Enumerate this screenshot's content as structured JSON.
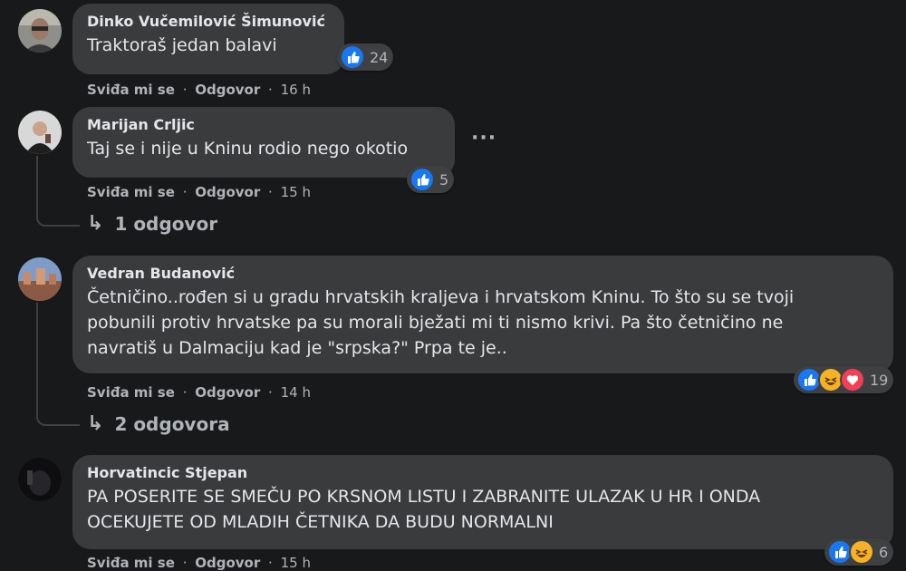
{
  "comments": [
    {
      "author": "Dinko Vučemilović Šimunović",
      "text": "Traktoraš jedan balavi",
      "like": "Sviđa mi se",
      "reply": "Odgovor",
      "time": "16 h",
      "reaction_count": "24"
    },
    {
      "author": "Marijan Crljic",
      "text": "Taj se i nije u Kninu rodio nego okotio",
      "like": "Sviđa mi se",
      "reply": "Odgovor",
      "time": "15 h",
      "reaction_count": "5",
      "replies_label": "1 odgovor"
    },
    {
      "author": "Vedran Budanović",
      "text": "Četničino..rođen si u gradu hrvatskih kraljeva i hrvatskom Kninu. To što su se tvoji\npobunili protiv hrvatske pa su morali bježati mi ti nismo krivi. Pa što četničino ne\nnavratiš u Dalmaciju kad je \"srpska?\" Prpa te je..",
      "like": "Sviđa mi se",
      "reply": "Odgovor",
      "time": "14 h",
      "reaction_count": "19",
      "replies_label": "2 odgovora"
    },
    {
      "author": "Horvatincic Stjepan",
      "text": "PA POSERITE SE SMEČU PO KRSNOM LISTU I ZABRANITE ULAZAK U HR I ONDA\nOCEKUJETE OD MLADIH ČETNIKA DA BUDU NORMALNI",
      "like": "Sviđa mi se",
      "reply": "Odgovor",
      "time": "15 h",
      "reaction_count": "6"
    }
  ],
  "separator": "·",
  "reply_arrow": "↳",
  "more_icon": "···",
  "colors": {
    "like": "#1877f2",
    "haha": "#f7b125",
    "love": "#f33e58",
    "bg": "#18191a",
    "bubble": "#3a3b3c"
  }
}
